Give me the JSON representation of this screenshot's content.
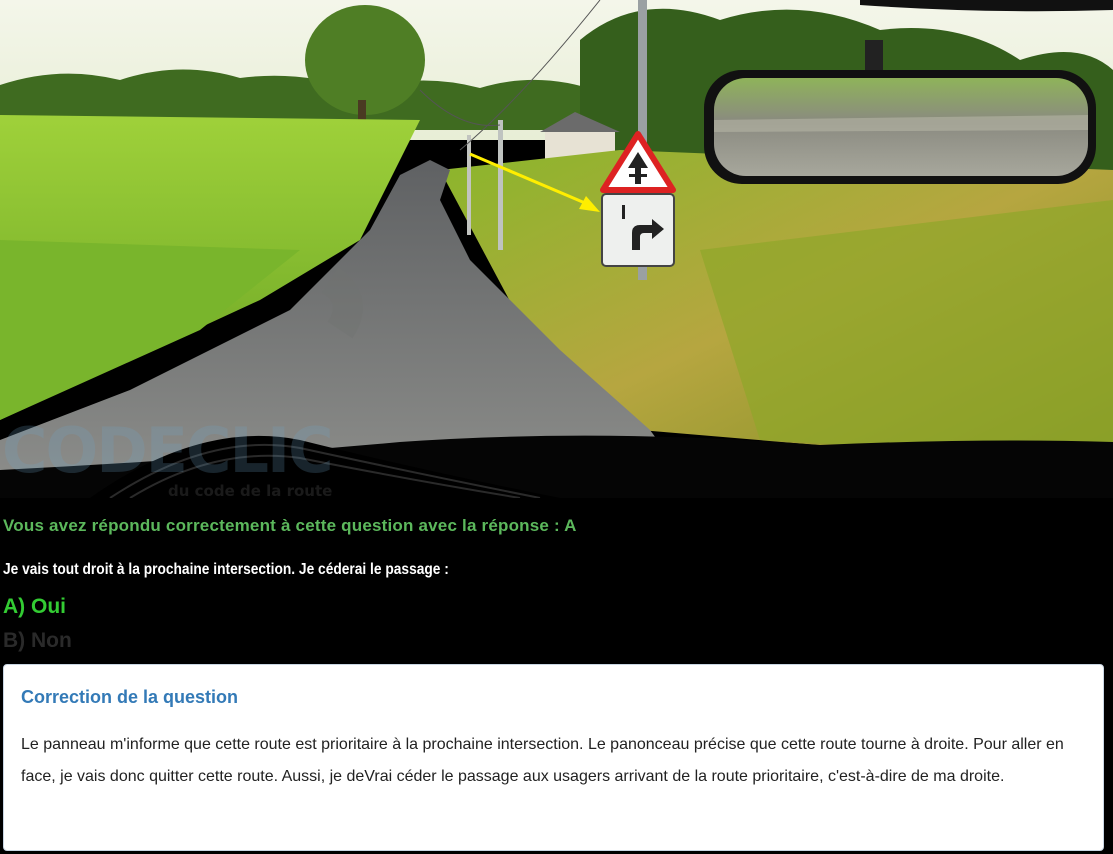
{
  "scene": {
    "sign_primary": "Priority road ahead warning sign (red triangle)",
    "sign_panel": "Road turns right panel",
    "watermark_brand": "CODECLIC",
    "watermark_tagline": "du code de la route"
  },
  "result_message": "Vous avez répondu correctement à cette question avec la réponse : A",
  "question": "Je vais tout droit à la prochaine intersection. Je céderai le passage :",
  "answers": [
    {
      "label": "A) Oui",
      "state": "correct",
      "color": "#33cc33"
    },
    {
      "label": "B) Non",
      "state": "inactive",
      "color": "#2a2a2a"
    }
  ],
  "correction": {
    "title": "Correction de la question",
    "text": "Le panneau m'informe que cette route est prioritaire à la prochaine intersection. Le panonceau précise que cette route tourne à droite. Pour aller en face, je vais donc quitter cette route. Aussi, je deVrai céder le passage aux usagers arrivant de la route prioritaire, c'est-à-dire de ma droite."
  },
  "colors": {
    "accent_green": "#5cb85c",
    "title_blue": "#337ab7",
    "background": "#000000"
  }
}
